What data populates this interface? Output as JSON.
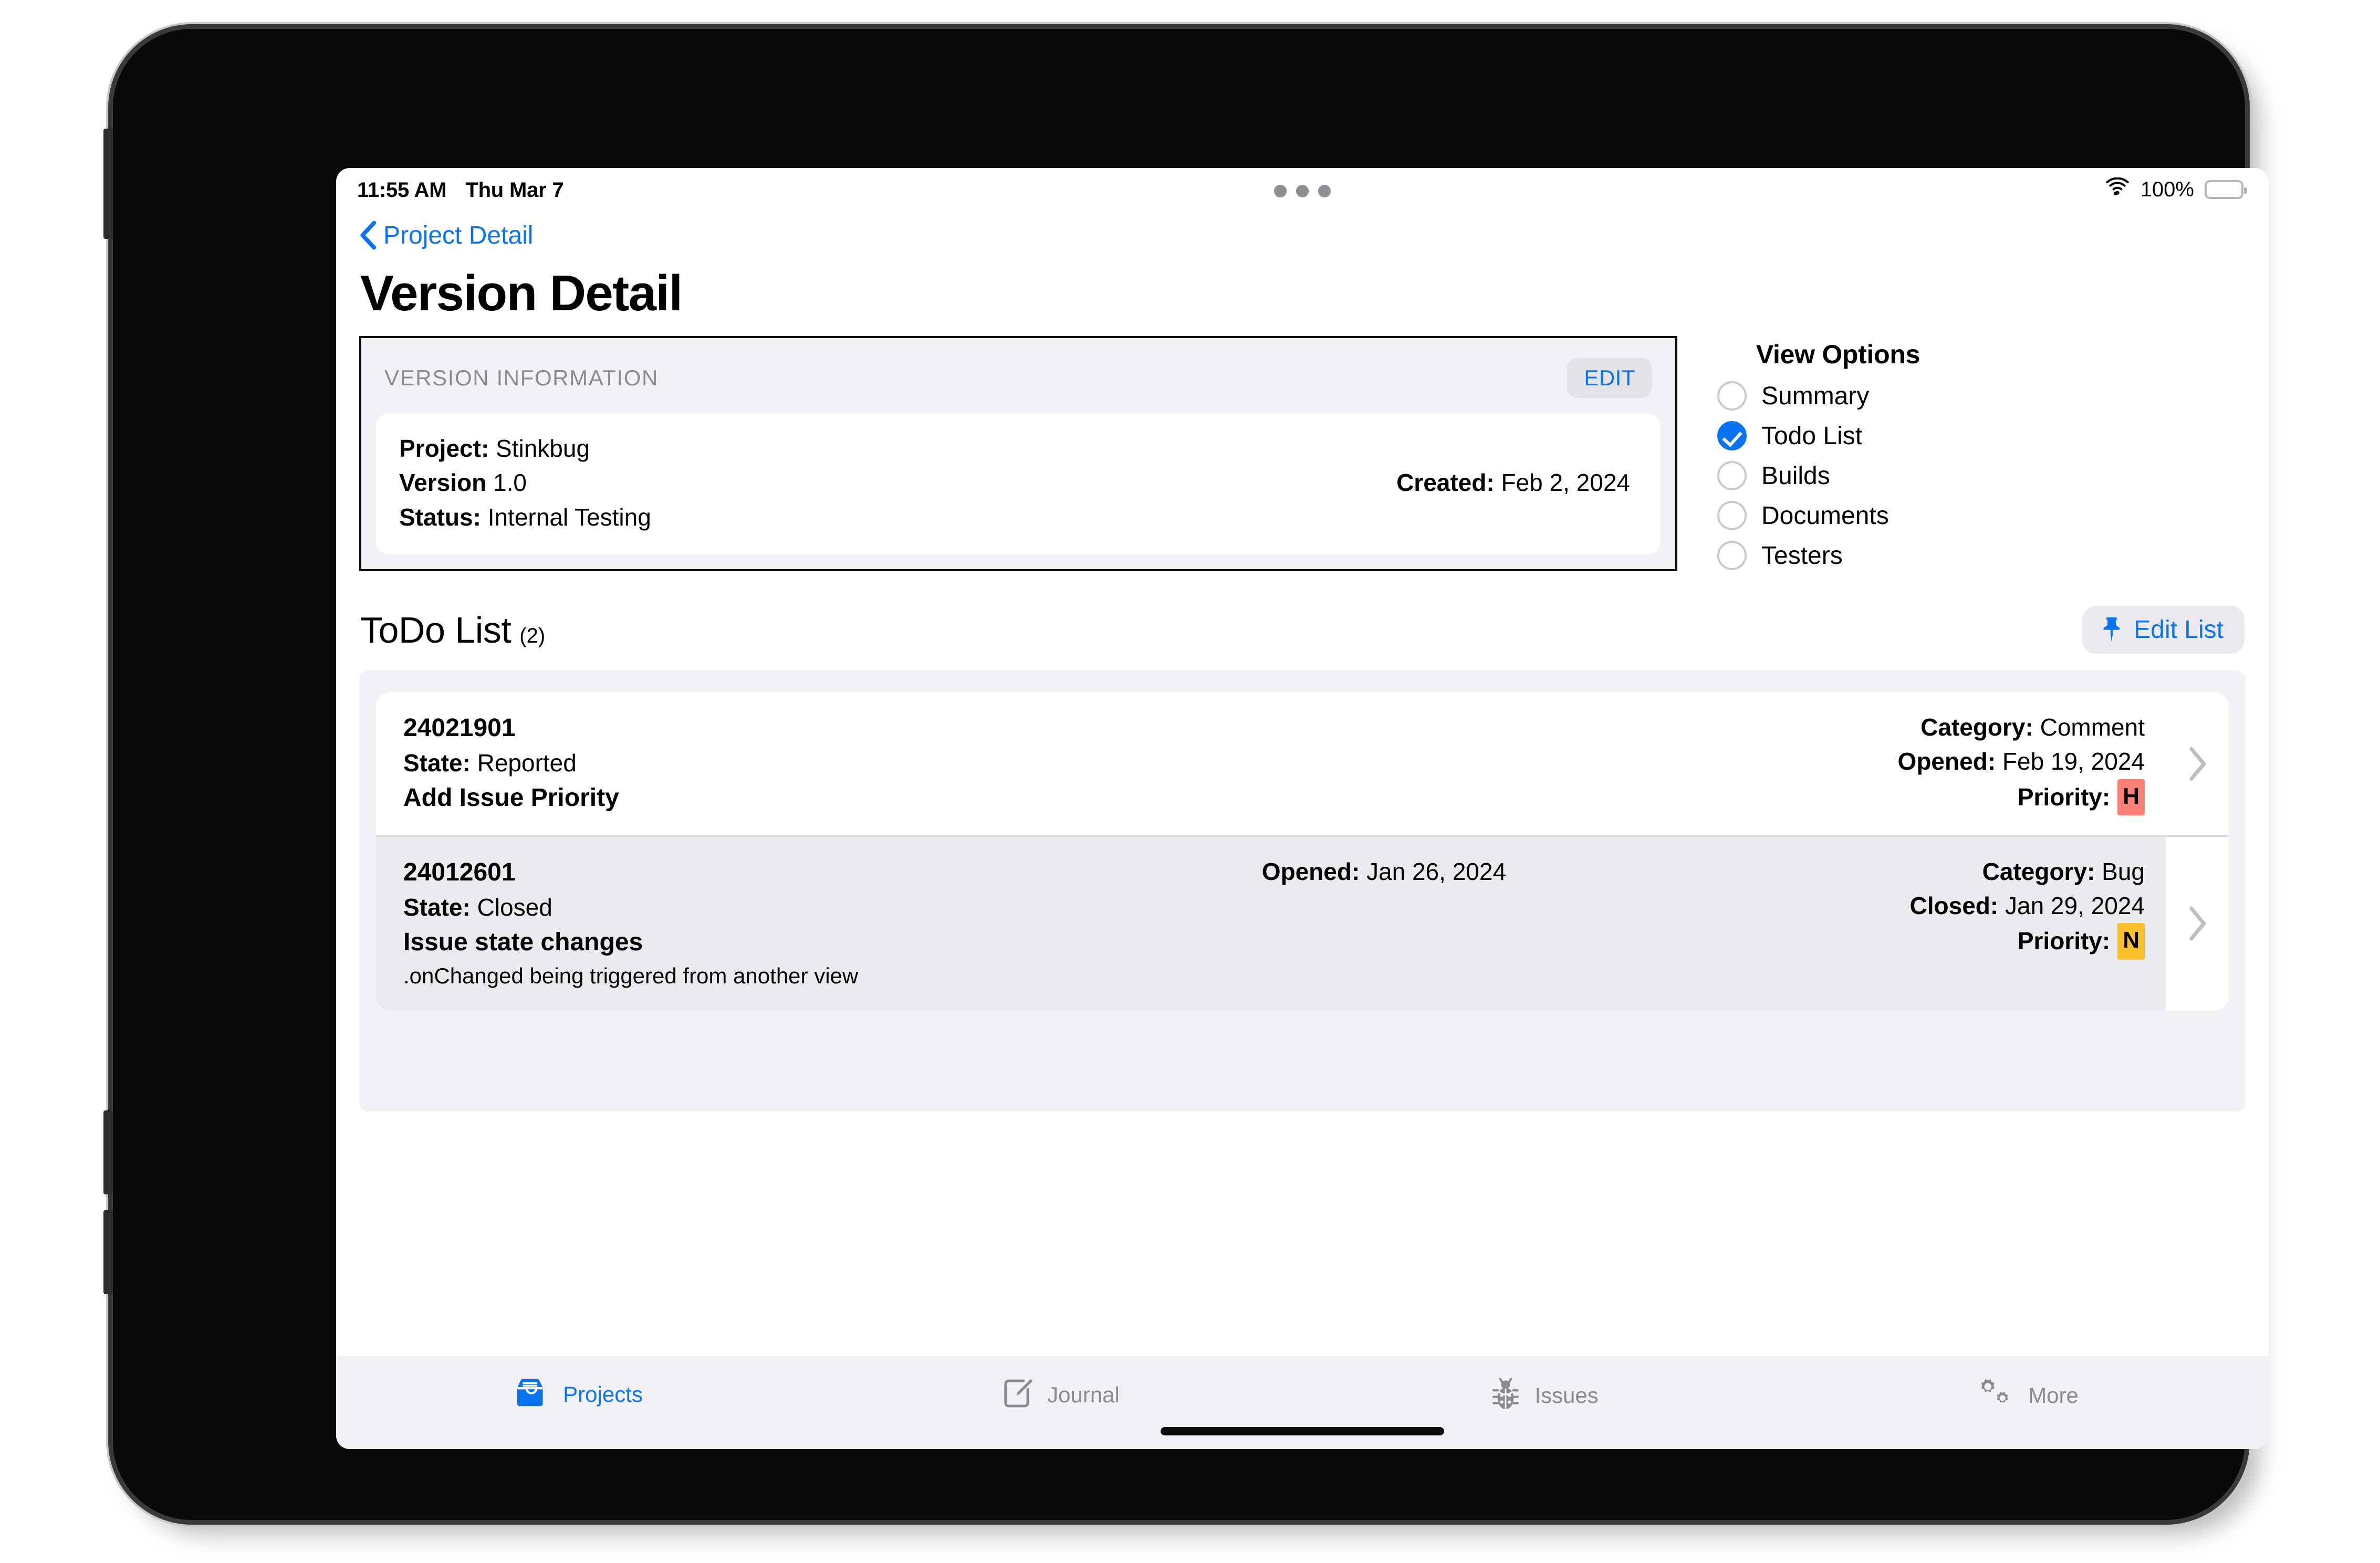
{
  "status_bar": {
    "time": "11:55 AM",
    "date": "Thu Mar 7",
    "battery_percent": "100%",
    "wifi_icon": "wifi-icon",
    "battery_icon": "battery-full-icon",
    "multitask_icon": "multitasking-dots-icon"
  },
  "nav": {
    "back_label": "Project Detail",
    "back_icon": "chevron-left-icon",
    "accent": "#0a74f0"
  },
  "page": {
    "title": "Version Detail"
  },
  "version_info": {
    "section_label": "VERSION INFORMATION",
    "edit_label": "EDIT",
    "fields": [
      {
        "label": "Project:",
        "value": "Stinkbug"
      },
      {
        "label": "Version",
        "value": "1.0"
      },
      {
        "label": "Status:",
        "value": "Internal Testing"
      }
    ],
    "created_label": "Created:",
    "created_value": "Feb 2, 2024"
  },
  "view_options": {
    "title": "View Options",
    "selected": "Todo List",
    "items": [
      {
        "label": "Summary",
        "selected": false
      },
      {
        "label": "Todo List",
        "selected": true
      },
      {
        "label": "Builds",
        "selected": false
      },
      {
        "label": "Documents",
        "selected": false
      },
      {
        "label": "Testers",
        "selected": false
      }
    ]
  },
  "todo_section": {
    "title": "ToDo List",
    "count": "(2)",
    "edit_list_label": "Edit List",
    "edit_list_icon": "pushpin-icon"
  },
  "todo_rows": [
    {
      "id": "24021901",
      "state_label": "State:",
      "state_value": "Reported",
      "summary": "Add Issue Priority",
      "note": "",
      "category_label": "Category:",
      "category_value": "Comment",
      "opened_label": "Opened:",
      "opened_value": "Feb 19, 2024",
      "closed_label": "",
      "closed_value": "",
      "mid_opened_label": "",
      "mid_opened_value": "",
      "priority_label": "Priority:",
      "priority_value": "H",
      "priority_color": "#fb8078",
      "chevron_icon": "chevron-right-icon",
      "highlighted": false
    },
    {
      "id": "24012601",
      "state_label": "State:",
      "state_value": "Closed",
      "summary": "Issue state changes",
      "note": ".onChanged being triggered from another view",
      "category_label": "Category:",
      "category_value": "Bug",
      "opened_label": "",
      "opened_value": "",
      "closed_label": "Closed:",
      "closed_value": "Jan 29, 2024",
      "mid_opened_label": "Opened:",
      "mid_opened_value": "Jan 26, 2024",
      "priority_label": "Priority:",
      "priority_value": "N",
      "priority_color": "#fbc02d",
      "chevron_icon": "chevron-right-icon",
      "highlighted": true
    }
  ],
  "tab_bar": {
    "items": [
      {
        "label": "Projects",
        "icon": "tray-icon",
        "active": true
      },
      {
        "label": "Journal",
        "icon": "square-pencil-icon",
        "active": false
      },
      {
        "label": "Issues",
        "icon": "ladybug-icon",
        "active": false
      },
      {
        "label": "More",
        "icon": "gears-icon",
        "active": false
      }
    ]
  }
}
